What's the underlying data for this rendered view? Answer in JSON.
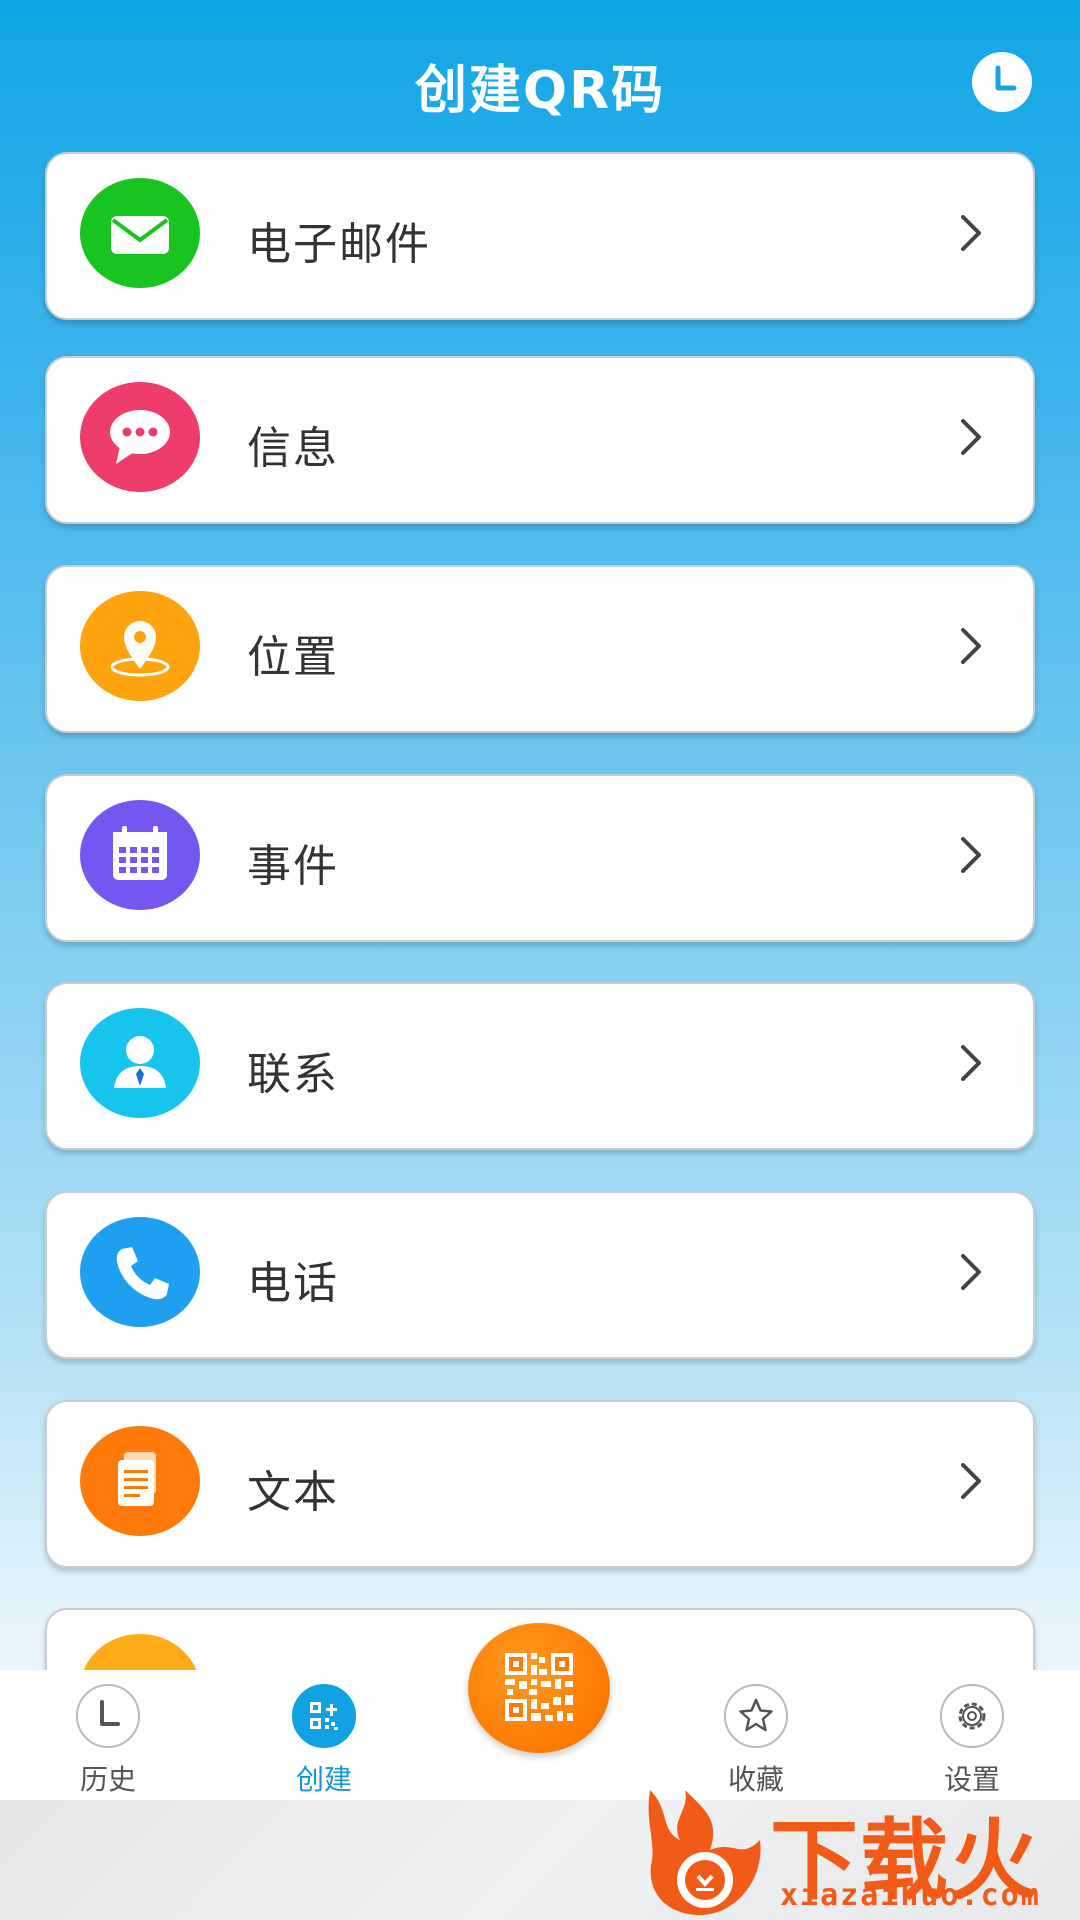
{
  "header": {
    "title": "创建QR码",
    "history_icon": "clock-icon"
  },
  "items": [
    {
      "label": "电子邮件",
      "icon": "email-icon",
      "color": "#18c41f"
    },
    {
      "label": "信息",
      "icon": "message-icon",
      "color": "#ef3d6b"
    },
    {
      "label": "位置",
      "icon": "location-icon",
      "color": "#ffa30f"
    },
    {
      "label": "事件",
      "icon": "calendar-icon",
      "color": "#7457f0"
    },
    {
      "label": "联系",
      "icon": "contact-icon",
      "color": "#17c4ee"
    },
    {
      "label": "电话",
      "icon": "phone-icon",
      "color": "#1e9ff0"
    },
    {
      "label": "文本",
      "icon": "text-icon",
      "color": "#ff7a0a"
    },
    {
      "label": "",
      "icon": "partial-icon",
      "color": "#ffac18"
    }
  ],
  "tabbar": {
    "tabs": [
      {
        "label": "历史",
        "icon": "clock-icon",
        "active": false
      },
      {
        "label": "创建",
        "icon": "qr-create-icon",
        "active": true
      },
      {
        "label": "收藏",
        "icon": "star-icon",
        "active": false
      },
      {
        "label": "设置",
        "icon": "gear-icon",
        "active": false
      }
    ],
    "fab_icon": "qr-code-icon",
    "fab_color": "#ff7a00"
  },
  "watermark": {
    "text": "下载火",
    "url": "xiazaihuo.com",
    "color": "#f25a17"
  }
}
